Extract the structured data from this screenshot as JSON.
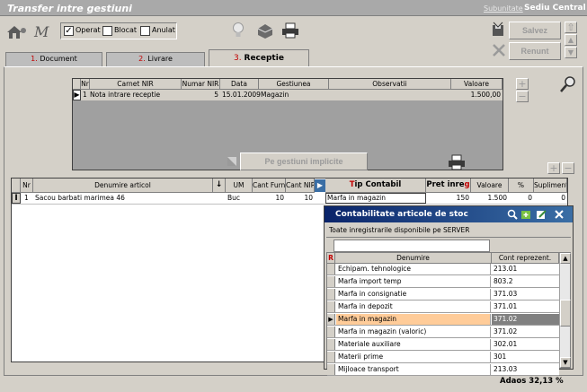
{
  "window": {
    "title": "Transfer intre gestiuni",
    "subunit_label": "Subunitate",
    "subunit_value": "Sediu Central"
  },
  "toolbar": {
    "operat_label": "Operat",
    "blocat_label": "Blocat",
    "anulat_label": "Anulat",
    "save_label": "Salvez",
    "cancel_label": "Renunt"
  },
  "tabs": [
    {
      "num": "1.",
      "label": "Document"
    },
    {
      "num": "2.",
      "label": "Livrare"
    },
    {
      "num": "3.",
      "label": "Receptie"
    }
  ],
  "nir_table": {
    "headers": [
      "Nr",
      "Carnet NIR",
      "Numar NIR",
      "Data",
      "Gestiunea",
      "Observatii",
      "Valoare"
    ],
    "row": {
      "nr": "1",
      "carnet": "Nota intrare receptie",
      "numar": "5",
      "data": "15.01.2009",
      "gestiunea": "Magazin",
      "observatii": "",
      "valoare": "1.500,00"
    }
  },
  "implicit_button": "Pe gestiuni implicite",
  "articles_table": {
    "headers": [
      "Nr",
      "Denumire articol",
      "UM",
      "Cant Furn",
      "Cant NIR",
      "Tip Contabil",
      "Pret inreg",
      "Valoare",
      "%",
      "Supliment"
    ],
    "row": {
      "nr": "1",
      "denumire": "Sacou barbati marimea 46",
      "um": "Buc",
      "cant_furn": "10",
      "cant_nir": "10",
      "tip_contabil": "Marfa in magazin",
      "pret": "150",
      "valoare": "1.500",
      "procent": "0",
      "supliment": "0"
    }
  },
  "popup": {
    "title": "Contabilitate articole de stoc",
    "subtitle": "Toate inregistrarile disponibile pe SERVER",
    "col_denumire": "Denumire",
    "col_cont": "Cont reprezent.",
    "rows": [
      {
        "denumire": "Echipam. tehnologice",
        "cont": "213.01"
      },
      {
        "denumire": "Marfa import temp",
        "cont": "803.2"
      },
      {
        "denumire": "Marfa in consignatie",
        "cont": "371.03"
      },
      {
        "denumire": "Marfa in depozit",
        "cont": "371.01"
      },
      {
        "denumire": "Marfa in magazin",
        "cont": "371.02"
      },
      {
        "denumire": "Marfa in magazin (valoric)",
        "cont": "371.02"
      },
      {
        "denumire": "Materiale auxiliare",
        "cont": "302.01"
      },
      {
        "denumire": "Materii prime",
        "cont": "301"
      },
      {
        "denumire": "Mijloace transport",
        "cont": "213.03"
      }
    ],
    "selected_index": 4
  },
  "status": {
    "adaos_label": "Adaos",
    "adaos_value": "32,13 %"
  },
  "colors": {
    "title_bg": "#a9a9a9",
    "popup_title_bg": "#0a246a",
    "selected_row": "#ffcc99",
    "selected_cont": "#808080",
    "tab_number": "#c00000"
  }
}
